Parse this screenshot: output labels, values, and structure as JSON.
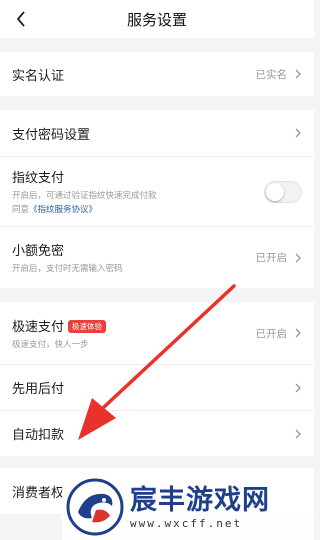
{
  "header": {
    "title": "服务设置"
  },
  "rows": {
    "realname": {
      "label": "实名认证",
      "value": "已实名"
    },
    "paypwd": {
      "label": "支付密码设置"
    },
    "fingerprint": {
      "label": "指纹支付",
      "desc": "开启后，可通过验证指纹快速完成付款",
      "agree_prefix": "同意",
      "agree_link": "《指纹服务协议》"
    },
    "nopwd": {
      "label": "小额免密",
      "desc": "开启后，支付时无需输入密码",
      "value": "已开启"
    },
    "fastpay": {
      "label": "极速支付",
      "badge": "极速体验",
      "desc": "极速支付，快人一步",
      "value": "已开启"
    },
    "paylater": {
      "label": "先用后付"
    },
    "autodebit": {
      "label": "自动扣款"
    },
    "consumer": {
      "label": "消费者权"
    }
  },
  "watermark": {
    "name": "宸丰游戏网",
    "url": "www.wxcff.net"
  },
  "colors": {
    "accent_red": "#e8413c",
    "link_blue": "#2d5fa0",
    "arrow_red": "#e8322b"
  }
}
